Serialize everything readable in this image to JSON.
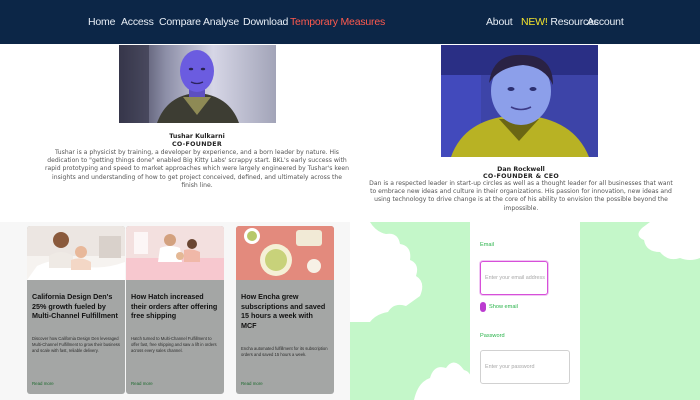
{
  "nav": {
    "home": "Home",
    "access": "Access",
    "compare": "Compare",
    "analyse": "Analyse",
    "download": "Download",
    "temporary_measures": "Temporary Measures",
    "about": "About",
    "resources_badge": "NEW!",
    "resources": " Resources",
    "account": "Account"
  },
  "colors": {
    "navbar": "#0c2647",
    "temporary_measures": "#ff5a4e",
    "new_badge": "#f2e32c",
    "card_bg": "#a4a6a5",
    "form_bg": "#c4f7c9",
    "form_accent": "#d74fd9"
  },
  "founders": [
    {
      "name": "Tushar Kulkarni",
      "role": "CO-FOUNDER",
      "bio": "Tushar is a physicist by training, a developer by experience, and a born leader by nature. His dedication to \"getting things done\" enabled Big Kitty Labs' scrappy start. BKL's early success with rapid prototyping and speed to market approaches which were largely engineered by Tushar's keen insights and understanding of how to get project conceived, defined, and ultimately across the finish line."
    },
    {
      "name": "Dan Rockwell",
      "role": "CO-FOUNDER & CEO",
      "bio": "Dan is a respected leader in start-up circles as well as a thought leader for all businesses that want to embrace new ideas and culture in their organizations. His passion for innovation, new ideas and using technology to drive change is at the core of his ability to envision the possible beyond the impossible."
    }
  ],
  "cards": [
    {
      "title": "California Design Den's 25% growth fueled by Multi-Channel Fulfillment",
      "desc": "Discover how California Design Den leveraged Multi-Channel Fulfillment to grow their business and scale with fast, reliable delivery.",
      "link": "Read more"
    },
    {
      "title": "How Hatch increased their orders after offering free shipping",
      "desc": "Hatch turned to Multi-Channel Fulfillment to offer fast, free shipping and saw a lift in orders across every sales channel.",
      "link": "Read more"
    },
    {
      "title": "How Encha grew subscriptions and saved 15 hours a week with MCF",
      "desc": "Encha automated fulfillment for its subscription orders and saved 15 hours a week.",
      "link": "Read more"
    }
  ],
  "form": {
    "email_label": "Email",
    "email_placeholder": "Enter your email address",
    "toggle_label": "Show email",
    "password_label": "Password",
    "password_placeholder": "Enter your password"
  }
}
